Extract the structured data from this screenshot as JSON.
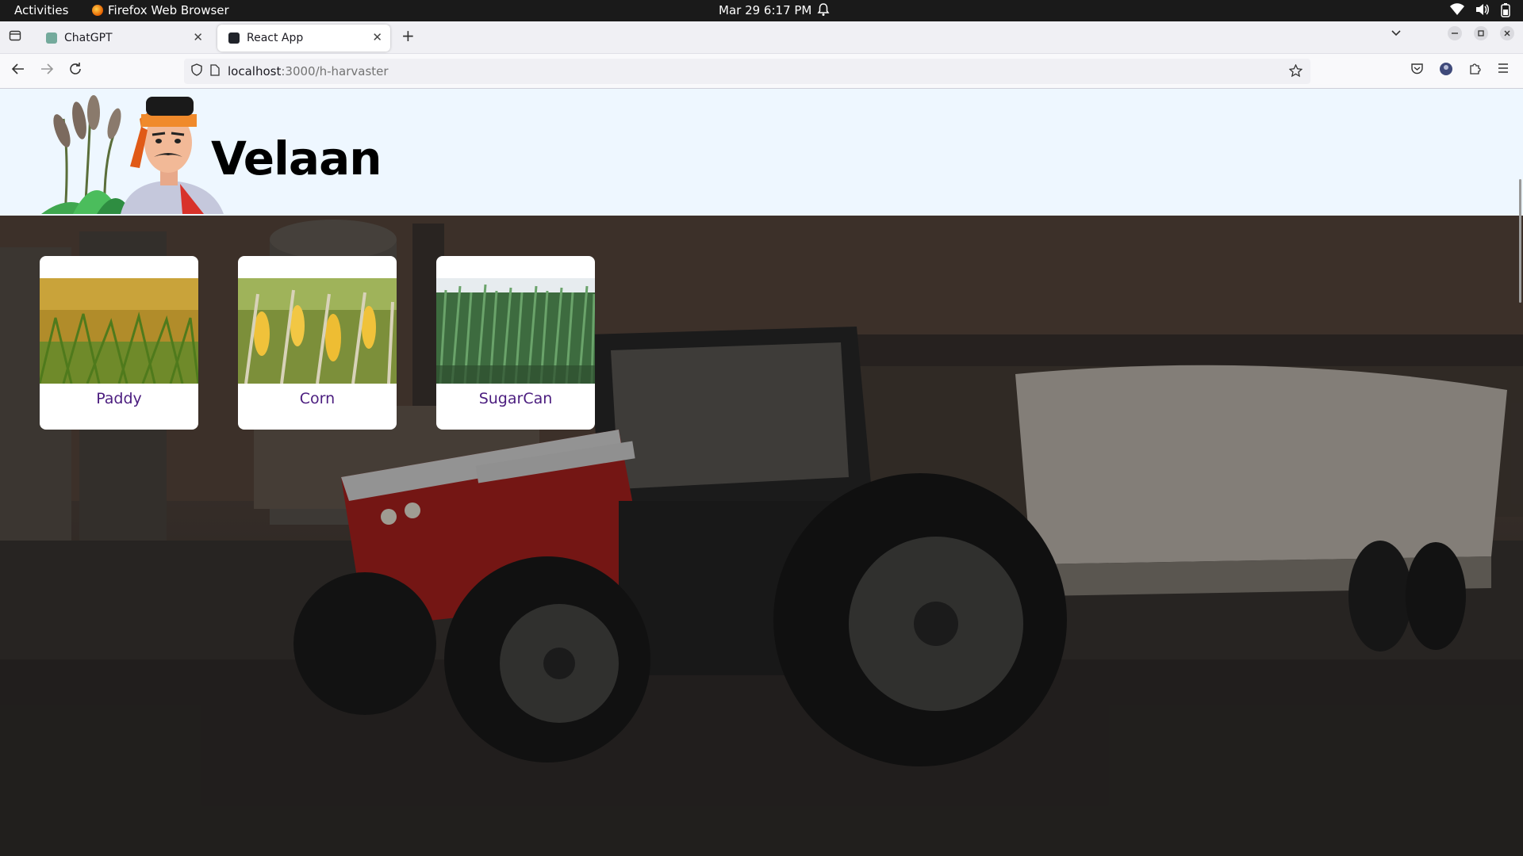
{
  "topbar": {
    "activities": "Activities",
    "app_name": "Firefox Web Browser",
    "clock": "Mar 29  6:17 PM"
  },
  "tabs": [
    {
      "label": "ChatGPT",
      "favicon_color": "#74aa9c"
    },
    {
      "label": "React App",
      "favicon_color": "#20232a"
    }
  ],
  "nav": {
    "url_host": "localhost",
    "url_path": ":3000/h-harvaster"
  },
  "header": {
    "brand": "Velaan"
  },
  "cards": [
    {
      "label": "Paddy",
      "image": "paddy-field"
    },
    {
      "label": "Corn",
      "image": "corn-field"
    },
    {
      "label": "SugarCan",
      "image": "sugarcane-field"
    }
  ],
  "colors": {
    "header_bg": "#eef7ff",
    "card_label": "#4b1d7f",
    "tractor_red": "#b3221f"
  }
}
